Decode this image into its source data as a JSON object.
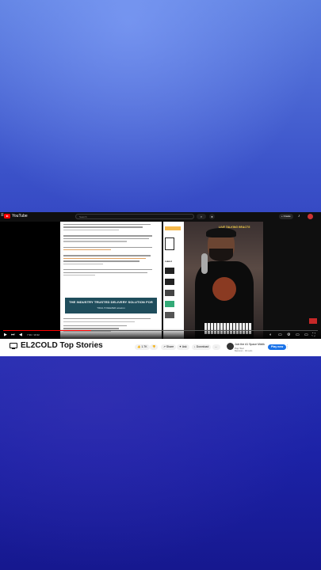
{
  "yt": {
    "logo": "YouTube",
    "search_placeholder": "Search",
    "create_label": "+ Create"
  },
  "video": {
    "title": "EL2COLD Top Stories",
    "overlay_label": "LIVE TALKING REACTS",
    "banner_title": "THE INDUSTRY TRUSTED DELIVERY SOLUTION FOR",
    "banner_sub": "TIDAL  ♥  DEEZER  amazon",
    "time": "7:30 / 19:32",
    "progress": 0.28
  },
  "actions": {
    "likes": "1.7K",
    "share": "Share",
    "ask": "Ask",
    "download": "Download",
    "more": "…"
  },
  "channel": {
    "name": "Join the #1 Space Mixtik",
    "sub": "Pop Tour",
    "meta": "Bastorum · 1M subs",
    "play_now": "Play now"
  }
}
